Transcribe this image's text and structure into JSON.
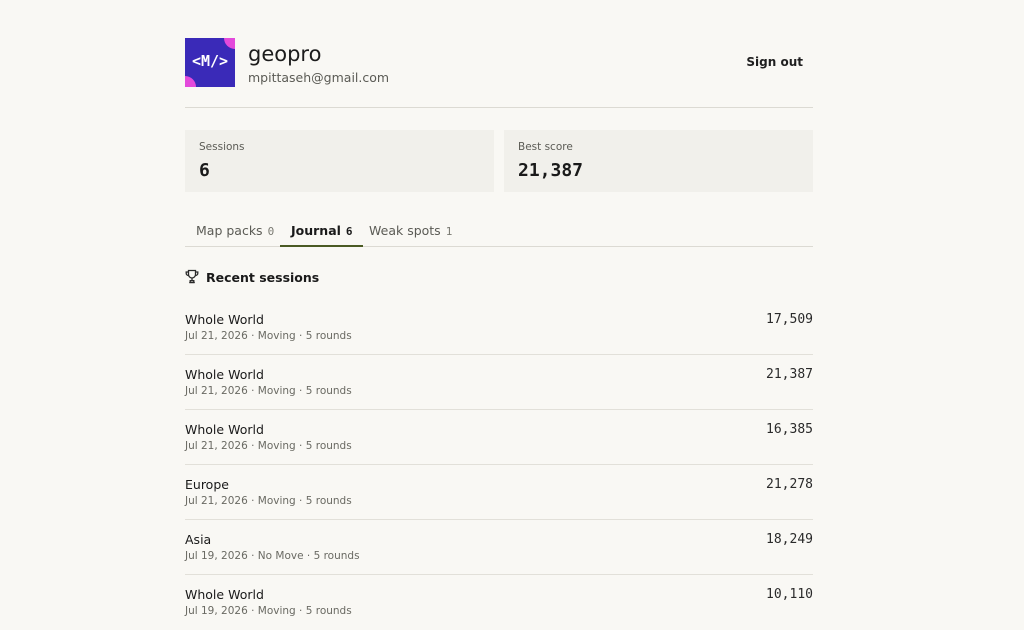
{
  "profile": {
    "avatar_glyph": "<M/>",
    "username": "geopro",
    "email": "mpittaseh@gmail.com",
    "sign_out_label": "Sign out"
  },
  "stats": [
    {
      "label": "Sessions",
      "value": "6"
    },
    {
      "label": "Best score",
      "value": "21,387"
    }
  ],
  "tabs": [
    {
      "label": "Map packs",
      "count": "0",
      "active": false
    },
    {
      "label": "Journal",
      "count": "6",
      "active": true
    },
    {
      "label": "Weak spots",
      "count": "1",
      "active": false
    }
  ],
  "section": {
    "icon": "trophy-icon",
    "title": "Recent sessions"
  },
  "sessions": [
    {
      "map": "Whole World",
      "meta": "Jul 21, 2026 · Moving · 5 rounds",
      "score": "17,509"
    },
    {
      "map": "Whole World",
      "meta": "Jul 21, 2026 · Moving · 5 rounds",
      "score": "21,387"
    },
    {
      "map": "Whole World",
      "meta": "Jul 21, 2026 · Moving · 5 rounds",
      "score": "16,385"
    },
    {
      "map": "Europe",
      "meta": "Jul 21, 2026 · Moving · 5 rounds",
      "score": "21,278"
    },
    {
      "map": "Asia",
      "meta": "Jul 19, 2026 · No Move · 5 rounds",
      "score": "18,249"
    },
    {
      "map": "Whole World",
      "meta": "Jul 19, 2026 · Moving · 5 rounds",
      "score": "10,110"
    }
  ],
  "colors": {
    "background": "#f9f8f4",
    "avatar_bg": "#3a2ab8",
    "avatar_accent": "#e34adb",
    "active_tab_underline": "#4a5a23"
  }
}
